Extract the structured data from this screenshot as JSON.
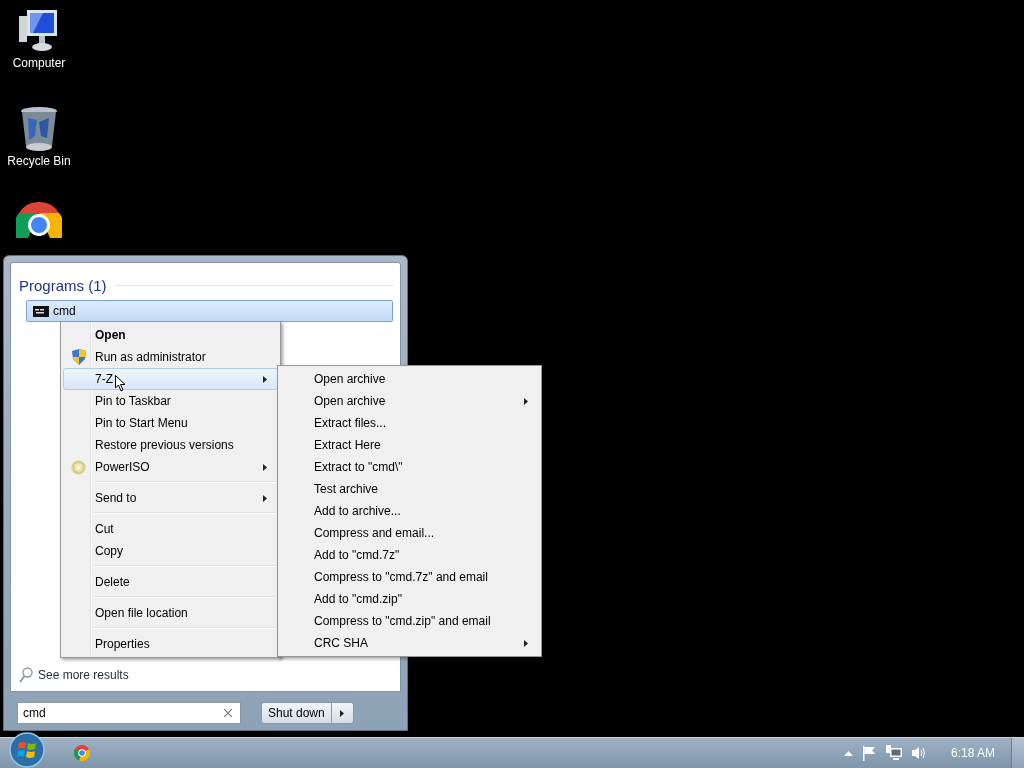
{
  "desktop_icons": [
    {
      "kind": "computer",
      "label": "Computer"
    },
    {
      "kind": "recycle-bin",
      "label": "Recycle Bin"
    },
    {
      "kind": "browser"
    }
  ],
  "start_menu": {
    "section_title": "Programs (1)",
    "results": [
      {
        "label": "cmd",
        "selected": true
      }
    ],
    "see_more": "See more results",
    "search": {
      "value": "cmd"
    },
    "shutdown_button": "Shut down"
  },
  "context_menu": {
    "items": [
      {
        "kind": "item",
        "label": "Open",
        "bold": true,
        "selected": false,
        "submenu": false
      },
      {
        "kind": "shielded",
        "label": "Run as administrator",
        "bold": false,
        "selected": false,
        "submenu": false
      },
      {
        "kind": "item",
        "label": "7-Z",
        "bold": false,
        "selected": true,
        "submenu": true,
        "cursor": true
      },
      {
        "kind": "item",
        "label": "Pin to Taskbar",
        "bold": false,
        "selected": false,
        "submenu": false
      },
      {
        "kind": "item",
        "label": "Pin to Start Menu",
        "bold": false,
        "selected": false,
        "submenu": false
      },
      {
        "kind": "item",
        "label": "Restore previous versions",
        "bold": false,
        "selected": false,
        "submenu": false
      },
      {
        "kind": "disc",
        "label": "PowerISO",
        "bold": false,
        "selected": false,
        "submenu": true
      },
      {
        "kind": "separator"
      },
      {
        "kind": "item",
        "label": "Send to",
        "bold": false,
        "selected": false,
        "submenu": true
      },
      {
        "kind": "separator"
      },
      {
        "kind": "item",
        "label": "Cut",
        "bold": false,
        "selected": false,
        "submenu": false
      },
      {
        "kind": "item",
        "label": "Copy",
        "bold": false,
        "selected": false,
        "submenu": false
      },
      {
        "kind": "separator"
      },
      {
        "kind": "item",
        "label": "Delete",
        "bold": false,
        "selected": false,
        "submenu": false
      },
      {
        "kind": "separator"
      },
      {
        "kind": "item",
        "label": "Open file location",
        "bold": false,
        "selected": false,
        "submenu": false
      },
      {
        "kind": "separator"
      },
      {
        "kind": "item",
        "label": "Properties",
        "bold": false,
        "selected": false,
        "submenu": false
      }
    ]
  },
  "submenu": {
    "items": [
      {
        "label": "Open archive",
        "submenu": false
      },
      {
        "label": "Open archive",
        "submenu": true
      },
      {
        "label": "Extract files...",
        "submenu": false
      },
      {
        "label": "Extract Here",
        "submenu": false
      },
      {
        "label": "Extract to \"cmd\\\"",
        "submenu": false
      },
      {
        "label": "Test archive",
        "submenu": false
      },
      {
        "label": "Add to archive...",
        "submenu": false
      },
      {
        "label": "Compress and email...",
        "submenu": false
      },
      {
        "label": "Add to \"cmd.7z\"",
        "submenu": false
      },
      {
        "label": "Compress to \"cmd.7z\" and email",
        "submenu": false
      },
      {
        "label": "Add to \"cmd.zip\"",
        "submenu": false
      },
      {
        "label": "Compress to \"cmd.zip\" and email",
        "submenu": false
      },
      {
        "label": "CRC SHA",
        "submenu": true
      }
    ]
  },
  "taskbar": {
    "clock": "6:18 AM"
  }
}
